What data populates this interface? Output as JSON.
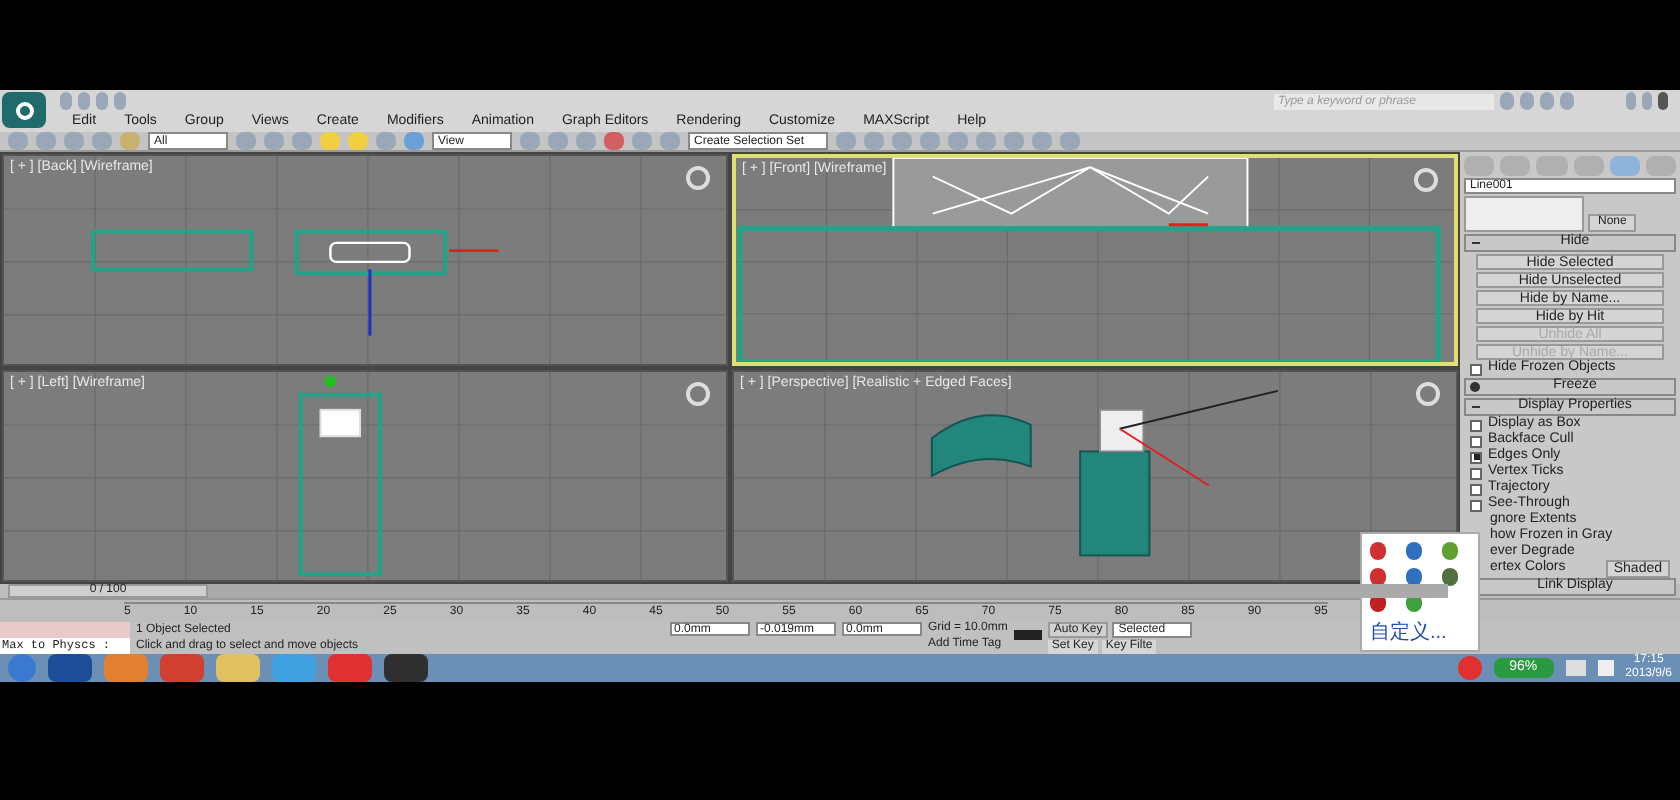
{
  "search": {
    "placeholder": "Type a keyword or phrase"
  },
  "menu": [
    "Edit",
    "Tools",
    "Group",
    "Views",
    "Create",
    "Modifiers",
    "Animation",
    "Graph Editors",
    "Rendering",
    "Customize",
    "MAXScript",
    "Help"
  ],
  "toolbar": {
    "filter": "All",
    "coordinate_system": "View",
    "selection_set": "Create Selection Set"
  },
  "viewports": [
    {
      "label": "[ + ] [Back] [Wireframe]",
      "selected": false,
      "kind": "top"
    },
    {
      "label": "[ + ] [Front] [Wireframe]",
      "selected": true,
      "kind": "front"
    },
    {
      "label": "[ + ] [Left] [Wireframe]",
      "selected": false,
      "kind": "left"
    },
    {
      "label": "[ + ] [Perspective] [Realistic + Edged Faces]",
      "selected": false,
      "kind": "perspective"
    }
  ],
  "command_panel": {
    "tabs": [
      {
        "selected": false
      },
      {
        "selected": false
      },
      {
        "selected": false
      },
      {
        "selected": false
      },
      {
        "selected": true
      },
      {
        "selected": false
      }
    ],
    "object_name": "Line001",
    "none_button": "None",
    "rollouts": [
      {
        "title": "Hide",
        "expanded": true,
        "items": [
          {
            "kind": "button",
            "label": "Hide Selected",
            "disabled": false
          },
          {
            "kind": "button",
            "label": "Hide Unselected",
            "disabled": false
          },
          {
            "kind": "button",
            "label": "Hide by Name...",
            "disabled": false
          },
          {
            "kind": "button",
            "label": "Hide by Hit",
            "disabled": false
          },
          {
            "kind": "button",
            "label": "Unhide All",
            "disabled": true
          },
          {
            "kind": "button",
            "label": "Unhide by Name...",
            "disabled": true
          },
          {
            "kind": "checkbox",
            "label": "Hide Frozen Objects",
            "checked": false
          }
        ]
      },
      {
        "title": "Freeze",
        "expanded": false
      },
      {
        "title": "Display Properties",
        "expanded": true,
        "items": [
          {
            "kind": "checkbox",
            "label": "Display as Box",
            "checked": false
          },
          {
            "kind": "checkbox",
            "label": "Backface Cull",
            "checked": false
          },
          {
            "kind": "checkbox",
            "label": "Edges Only",
            "checked": true
          },
          {
            "kind": "checkbox",
            "label": "Vertex Ticks",
            "checked": false
          },
          {
            "kind": "checkbox",
            "label": "Trajectory",
            "checked": false
          },
          {
            "kind": "checkbox",
            "label": "See-Through",
            "checked": false
          },
          {
            "kind": "text",
            "label": "gnore Extents"
          },
          {
            "kind": "text",
            "label": "how Frozen in Gray"
          },
          {
            "kind": "text",
            "label": "ever Degrade"
          },
          {
            "kind": "text",
            "label": "ertex Colors",
            "button": "Shaded"
          }
        ]
      },
      {
        "title": "Link Display",
        "expanded": false
      }
    ]
  },
  "timeline": {
    "frame": "0 / 100",
    "level": 0,
    "ticks": [
      "5",
      "10",
      "15",
      "20",
      "25",
      "30",
      "35",
      "40",
      "45",
      "50",
      "55",
      "60",
      "65",
      "70",
      "75",
      "80",
      "85",
      "90",
      "95"
    ]
  },
  "status": {
    "script_listener": "Max to Physcs :",
    "selection": "1 Object Selected",
    "prompt": "Click and drag to select and move objects",
    "x": "0.0mm",
    "y": "-0.019mm",
    "z": "0.0mm",
    "grid": "Grid = 10.0mm",
    "time_tag": "Add Time Tag",
    "auto_key": "Auto Key",
    "key_mode": "Selected",
    "set_key": "Set Key",
    "key_filters": "Key Filte"
  },
  "tray_popup": {
    "customize": "自定义..."
  },
  "taskbar": {
    "battery": "96%",
    "time": "17:15",
    "date": "2013/9/6"
  }
}
